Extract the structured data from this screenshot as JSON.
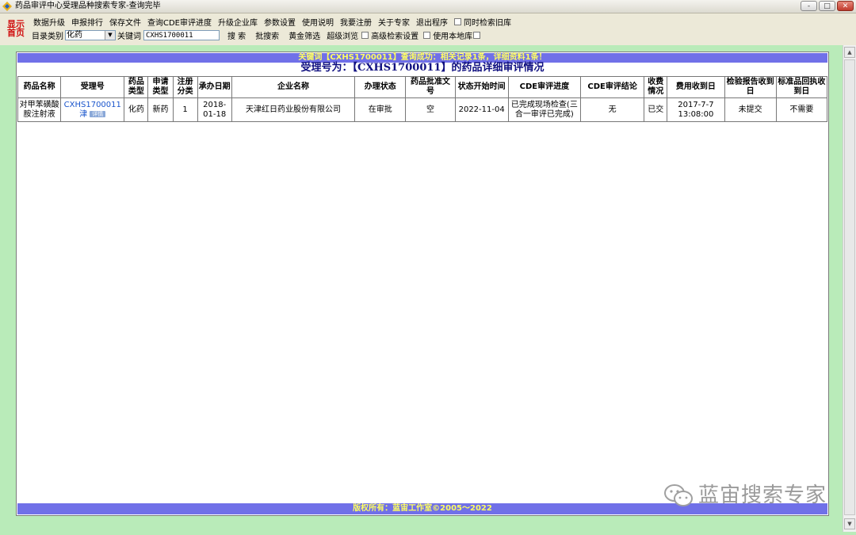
{
  "window": {
    "title": "药品审评中心受理品种搜索专家-查询完毕",
    "buttons": {
      "minimize": "-",
      "maximize": "□",
      "close": "✕"
    }
  },
  "toolbar": {
    "home_logo": [
      "显示",
      "首页"
    ],
    "menu": [
      "数据升级",
      "申报排行",
      "保存文件",
      "查询CDE审评进度",
      "升级企业库",
      "参数设置",
      "使用说明",
      "我要注册",
      "关于专家",
      "退出程序"
    ],
    "check_old_db": "同时检索旧库",
    "category_label": "目录类别",
    "category_value": "化药",
    "keyword_label": "关键词",
    "keyword_value": "CXHS1700011",
    "search_button": "搜  索",
    "batch_search": "批搜索",
    "gold_filter": "黄金筛选",
    "super_browse": "超级浏览",
    "advanced_search": "高级检索设置",
    "local_db": "使用本地库"
  },
  "result": {
    "banner": "关键词【CXHS1700011】查询成功：相关记录1条，详细资料1条！",
    "heading": "受理号为：【CXHS1700011】的药品详细审评情况",
    "columns": [
      "药品名称",
      "受理号",
      "药品类型",
      "申请类型",
      "注册分类",
      "承办日期",
      "企业名称",
      "办理状态",
      "药品批准文号",
      "状态开始时间",
      "CDE审评进度",
      "CDE审评结论",
      "收费情况",
      "费用收到日",
      "检验报告收到日",
      "标准品回执收到日"
    ],
    "rows": [
      {
        "drug_name": "对甲苯磺酸胺注射液",
        "accept_no": "CXHS1700011",
        "accept_region": "津",
        "accept_tag": "详情",
        "drug_type": "化药",
        "apply_type": "新药",
        "reg_class": "1",
        "accept_date": "2018-01-18",
        "company": "天津红日药业股份有限公司",
        "status": "在审批",
        "approval_no": "空",
        "status_start": "2022-11-04",
        "cde_progress": "已完成现场检查(三合一审评已完成)",
        "cde_conclusion": "无",
        "fee_status": "已交",
        "fee_date": "2017-7-7 13:08:00",
        "report_date": "未提交",
        "standard_date": "不需要"
      }
    ],
    "footer": "版权所有：蓝宙工作室©2005～2022"
  },
  "watermark": "蓝宙搜索专家",
  "colors": {
    "accent_banner": "#7070e8",
    "banner_text": "#ffff60",
    "background": "#b9ebb9",
    "heading": "#101080",
    "logo": "#d01010"
  }
}
